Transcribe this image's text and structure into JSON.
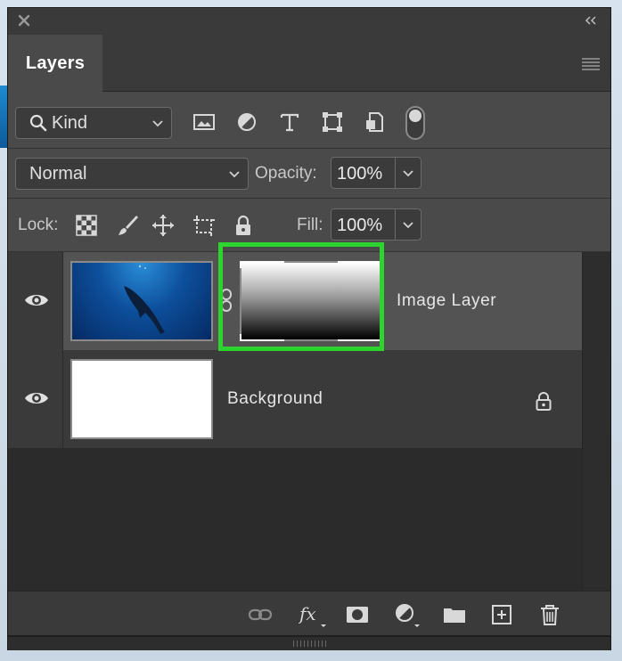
{
  "panel": {
    "tab_label": "Layers"
  },
  "filter": {
    "kind_label": "Kind"
  },
  "blend": {
    "mode": "Normal",
    "opacity_label": "Opacity:",
    "opacity_value": "100%"
  },
  "lock": {
    "label": "Lock:",
    "fill_label": "Fill:",
    "fill_value": "100%"
  },
  "layers": [
    {
      "name": "Image Layer",
      "visible": true,
      "has_mask": true,
      "locked": false
    },
    {
      "name": "Background",
      "visible": true,
      "has_mask": false,
      "locked": true
    }
  ],
  "colors": {
    "highlight": "#2ed42e",
    "panel_bg": "#2b2b2b"
  },
  "icons": {
    "titlebar": [
      "close-icon",
      "collapse-icon"
    ],
    "filter": [
      "image-filter-icon",
      "adjustment-filter-icon",
      "type-filter-icon",
      "shape-filter-icon",
      "smart-object-filter-icon",
      "filter-toggle"
    ],
    "lock": [
      "lock-transparent-icon",
      "lock-brush-icon",
      "lock-move-icon",
      "lock-artboard-icon",
      "lock-all-icon"
    ],
    "footer": [
      "link-layers-icon",
      "fx-icon",
      "add-mask-icon",
      "new-adjustment-icon",
      "new-group-icon",
      "new-layer-icon",
      "delete-icon"
    ]
  }
}
